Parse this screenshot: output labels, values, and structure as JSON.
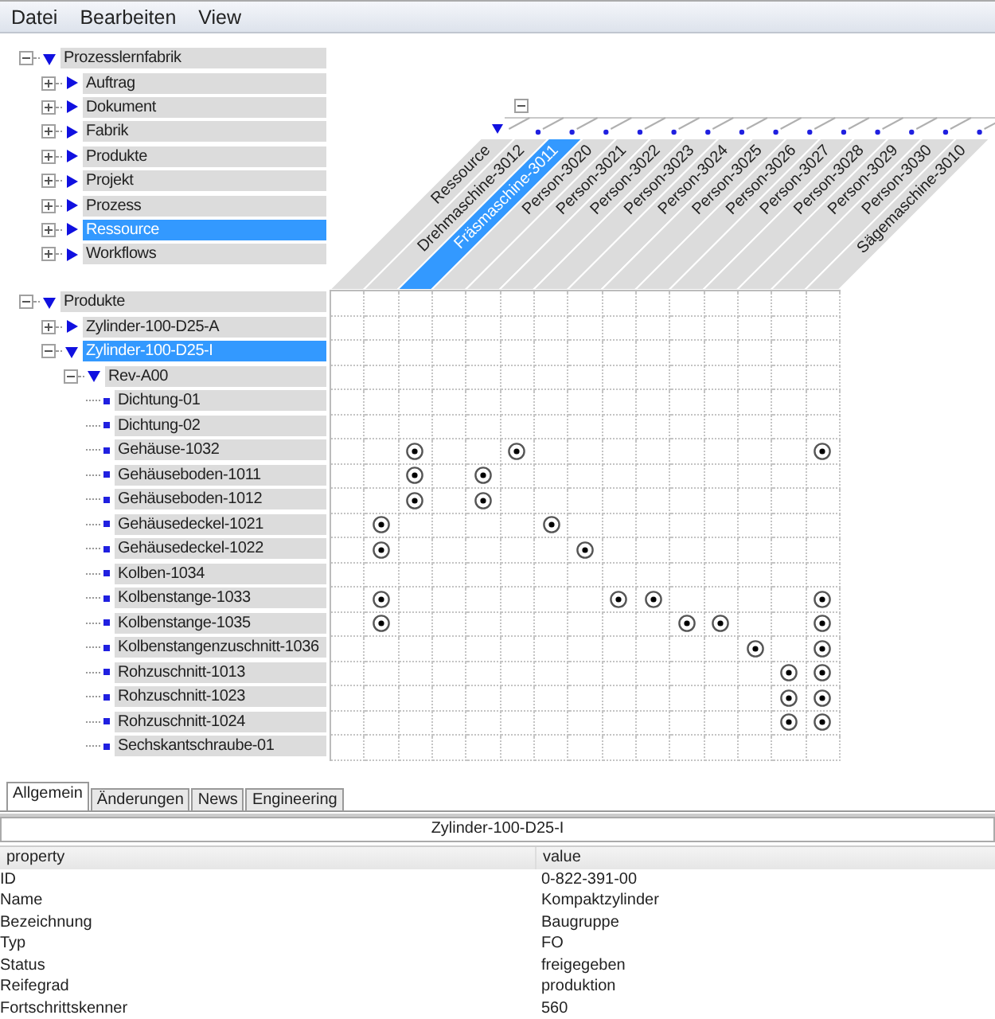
{
  "menu": [
    "Datei",
    "Bearbeiten",
    "View"
  ],
  "top_tree": {
    "label": "Prozesslernfabrik",
    "expanded": true,
    "selected": false,
    "children": [
      {
        "label": "Auftrag",
        "expanded": false,
        "selected": false
      },
      {
        "label": "Dokument",
        "expanded": false,
        "selected": false
      },
      {
        "label": "Fabrik",
        "expanded": false,
        "selected": false
      },
      {
        "label": "Produkte",
        "expanded": false,
        "selected": false
      },
      {
        "label": "Projekt",
        "expanded": false,
        "selected": false
      },
      {
        "label": "Prozess",
        "expanded": false,
        "selected": false
      },
      {
        "label": "Ressource",
        "expanded": false,
        "selected": true
      },
      {
        "label": "Workflows",
        "expanded": false,
        "selected": false
      }
    ]
  },
  "column_tree": {
    "label": "Ressource",
    "expanded": true,
    "selected": false,
    "children": [
      {
        "label": "Drehmaschine-3012",
        "selected": false
      },
      {
        "label": "Fräsmaschine-3011",
        "selected": true
      },
      {
        "label": "Person-3020",
        "selected": false
      },
      {
        "label": "Person-3021",
        "selected": false
      },
      {
        "label": "Person-3022",
        "selected": false
      },
      {
        "label": "Person-3023",
        "selected": false
      },
      {
        "label": "Person-3024",
        "selected": false
      },
      {
        "label": "Person-3025",
        "selected": false
      },
      {
        "label": "Person-3026",
        "selected": false
      },
      {
        "label": "Person-3027",
        "selected": false
      },
      {
        "label": "Person-3028",
        "selected": false
      },
      {
        "label": "Person-3029",
        "selected": false
      },
      {
        "label": "Person-3030",
        "selected": false
      },
      {
        "label": "Sägemaschine-3010",
        "selected": false
      }
    ]
  },
  "row_tree": {
    "label": "Produkte",
    "expanded": true,
    "selected": false,
    "cells": [
      false,
      false,
      false,
      false,
      false,
      false,
      false,
      false,
      false,
      false,
      false,
      false,
      false,
      false,
      false
    ],
    "children": [
      {
        "label": "Zylinder-100-D25-A",
        "expanded": false,
        "selected": false,
        "cells": [
          false,
          false,
          false,
          false,
          false,
          false,
          false,
          false,
          false,
          false,
          false,
          false,
          false,
          false,
          false
        ]
      },
      {
        "label": "Zylinder-100-D25-I",
        "expanded": true,
        "selected": true,
        "cells": [
          false,
          false,
          false,
          false,
          false,
          false,
          false,
          false,
          false,
          false,
          false,
          false,
          false,
          false,
          false
        ],
        "children": [
          {
            "label": "Rev-A00",
            "expanded": true,
            "selected": false,
            "cells": [
              false,
              false,
              false,
              false,
              false,
              false,
              false,
              false,
              false,
              false,
              false,
              false,
              false,
              false,
              false
            ],
            "children": [
              {
                "label": "Dichtung-01",
                "selected": false,
                "cells": [
                  false,
                  false,
                  false,
                  false,
                  false,
                  false,
                  false,
                  false,
                  false,
                  false,
                  false,
                  false,
                  false,
                  false,
                  false
                ]
              },
              {
                "label": "Dichtung-02",
                "selected": false,
                "cells": [
                  false,
                  false,
                  false,
                  false,
                  false,
                  false,
                  false,
                  false,
                  false,
                  false,
                  false,
                  false,
                  false,
                  false,
                  false
                ]
              },
              {
                "label": "Gehäuse-1032",
                "selected": false,
                "cells": [
                  false,
                  false,
                  true,
                  false,
                  false,
                  true,
                  false,
                  false,
                  false,
                  false,
                  false,
                  false,
                  false,
                  false,
                  true
                ]
              },
              {
                "label": "Gehäuseboden-1011",
                "selected": false,
                "cells": [
                  false,
                  false,
                  true,
                  false,
                  true,
                  false,
                  false,
                  false,
                  false,
                  false,
                  false,
                  false,
                  false,
                  false,
                  false
                ]
              },
              {
                "label": "Gehäuseboden-1012",
                "selected": false,
                "cells": [
                  false,
                  false,
                  true,
                  false,
                  true,
                  false,
                  false,
                  false,
                  false,
                  false,
                  false,
                  false,
                  false,
                  false,
                  false
                ]
              },
              {
                "label": "Gehäusedeckel-1021",
                "selected": false,
                "cells": [
                  false,
                  true,
                  false,
                  false,
                  false,
                  false,
                  true,
                  false,
                  false,
                  false,
                  false,
                  false,
                  false,
                  false,
                  false
                ]
              },
              {
                "label": "Gehäusedeckel-1022",
                "selected": false,
                "cells": [
                  false,
                  true,
                  false,
                  false,
                  false,
                  false,
                  false,
                  true,
                  false,
                  false,
                  false,
                  false,
                  false,
                  false,
                  false
                ]
              },
              {
                "label": "Kolben-1034",
                "selected": false,
                "cells": [
                  false,
                  false,
                  false,
                  false,
                  false,
                  false,
                  false,
                  false,
                  false,
                  false,
                  false,
                  false,
                  false,
                  false,
                  false
                ]
              },
              {
                "label": "Kolbenstange-1033",
                "selected": false,
                "cells": [
                  false,
                  true,
                  false,
                  false,
                  false,
                  false,
                  false,
                  false,
                  true,
                  true,
                  false,
                  false,
                  false,
                  false,
                  true
                ]
              },
              {
                "label": "Kolbenstange-1035",
                "selected": false,
                "cells": [
                  false,
                  true,
                  false,
                  false,
                  false,
                  false,
                  false,
                  false,
                  false,
                  false,
                  true,
                  true,
                  false,
                  false,
                  true
                ]
              },
              {
                "label": "Kolbenstangenzuschnitt-1036",
                "selected": false,
                "cells": [
                  false,
                  false,
                  false,
                  false,
                  false,
                  false,
                  false,
                  false,
                  false,
                  false,
                  false,
                  false,
                  true,
                  false,
                  true
                ]
              },
              {
                "label": "Rohzuschnitt-1013",
                "selected": false,
                "cells": [
                  false,
                  false,
                  false,
                  false,
                  false,
                  false,
                  false,
                  false,
                  false,
                  false,
                  false,
                  false,
                  false,
                  true,
                  true
                ]
              },
              {
                "label": "Rohzuschnitt-1023",
                "selected": false,
                "cells": [
                  false,
                  false,
                  false,
                  false,
                  false,
                  false,
                  false,
                  false,
                  false,
                  false,
                  false,
                  false,
                  false,
                  true,
                  true
                ]
              },
              {
                "label": "Rohzuschnitt-1024",
                "selected": false,
                "cells": [
                  false,
                  false,
                  false,
                  false,
                  false,
                  false,
                  false,
                  false,
                  false,
                  false,
                  false,
                  false,
                  false,
                  true,
                  true
                ]
              },
              {
                "label": "Sechskantschraube-01",
                "selected": false,
                "cells": [
                  false,
                  false,
                  false,
                  false,
                  false,
                  false,
                  false,
                  false,
                  false,
                  false,
                  false,
                  false,
                  false,
                  false,
                  false
                ]
              }
            ]
          }
        ]
      }
    ]
  },
  "tabs": [
    {
      "label": "Allgemein",
      "selected": true
    },
    {
      "label": "Änderungen",
      "selected": false
    },
    {
      "label": "News",
      "selected": false
    },
    {
      "label": "Engineering",
      "selected": false
    }
  ],
  "details": {
    "title": "Zylinder-100-D25-I",
    "columns": [
      "property",
      "value"
    ],
    "rows": [
      [
        "ID",
        "0-822-391-00"
      ],
      [
        "Name",
        "Kompaktzylinder"
      ],
      [
        "Bezeichnung",
        "Baugruppe"
      ],
      [
        "Typ",
        "FO"
      ],
      [
        "Status",
        "freigegeben"
      ],
      [
        "Reifegrad",
        "produktion"
      ],
      [
        "Fortschrittskenner",
        "560"
      ]
    ]
  }
}
